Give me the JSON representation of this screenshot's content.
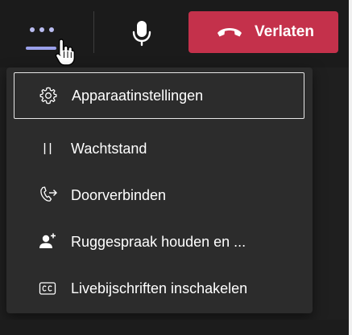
{
  "toolbar": {
    "more_icon": "more-options-icon",
    "mic_icon": "microphone-icon",
    "leave": {
      "label": "Verlaten",
      "icon": "hang-up-icon",
      "color": "#c4314b"
    }
  },
  "menu": {
    "items": [
      {
        "label": "Apparaatinstellingen",
        "icon": "gear-icon",
        "focused": true
      },
      {
        "label": "Wachtstand",
        "icon": "pause-icon",
        "focused": false
      },
      {
        "label": "Doorverbinden",
        "icon": "call-transfer-icon",
        "focused": false
      },
      {
        "label": "Ruggespraak houden en ...",
        "icon": "person-add-icon",
        "focused": false
      },
      {
        "label": "Livebijschriften inschakelen",
        "icon": "closed-captions-icon",
        "focused": false
      }
    ]
  },
  "colors": {
    "background": "#1f1f1f",
    "menu_background": "#2c2c2c",
    "accent": "#9aa0ea"
  }
}
